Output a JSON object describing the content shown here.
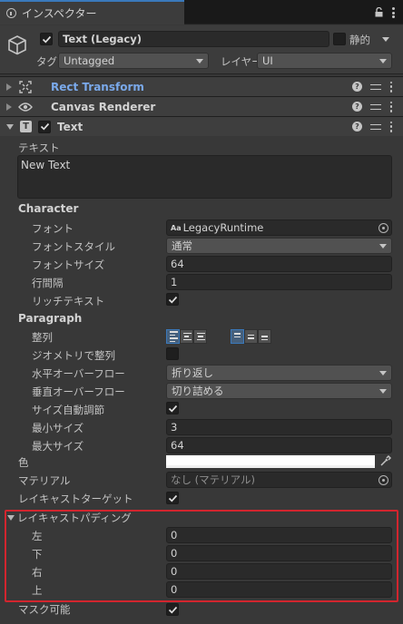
{
  "tab": {
    "title": "インスペクター"
  },
  "header": {
    "object_name": "Text (Legacy)",
    "static_label": "静的",
    "tag_label": "タグ",
    "tag_value": "Untagged",
    "layer_label": "レイヤー",
    "layer_value": "UI"
  },
  "components": {
    "rect_transform": "Rect Transform",
    "canvas_renderer": "Canvas Renderer",
    "text": "Text"
  },
  "text": {
    "text_label": "テキスト",
    "text_value": "New Text",
    "character_header": "Character",
    "font_label": "フォント",
    "font_value": "LegacyRuntime",
    "font_style_label": "フォントスタイル",
    "font_style_value": "通常",
    "font_size_label": "フォントサイズ",
    "font_size_value": "64",
    "line_spacing_label": "行間隔",
    "line_spacing_value": "1",
    "rich_text_label": "リッチテキスト",
    "paragraph_header": "Paragraph",
    "alignment_label": "整列",
    "align_geometry_label": "ジオメトリで整列",
    "h_overflow_label": "水平オーバーフロー",
    "h_overflow_value": "折り返し",
    "v_overflow_label": "垂直オーバーフロー",
    "v_overflow_value": "切り詰める",
    "best_fit_label": "サイズ自動調節",
    "min_size_label": "最小サイズ",
    "min_size_value": "3",
    "max_size_label": "最大サイズ",
    "max_size_value": "64",
    "color_label": "色",
    "material_label": "マテリアル",
    "material_value": "なし (マテリアル)",
    "raycast_target_label": "レイキャストターゲット",
    "raycast_padding_label": "レイキャストパディング",
    "pad_left_label": "左",
    "pad_left_value": "0",
    "pad_bottom_label": "下",
    "pad_bottom_value": "0",
    "pad_right_label": "右",
    "pad_right_value": "0",
    "pad_top_label": "上",
    "pad_top_value": "0",
    "maskable_label": "マスク可能",
    "font_icon_text": "Aa"
  },
  "colors": {
    "accent": "#3a79bb",
    "highlight_box": "#d2252e",
    "rect_transform_title": "#7aa9ea"
  }
}
